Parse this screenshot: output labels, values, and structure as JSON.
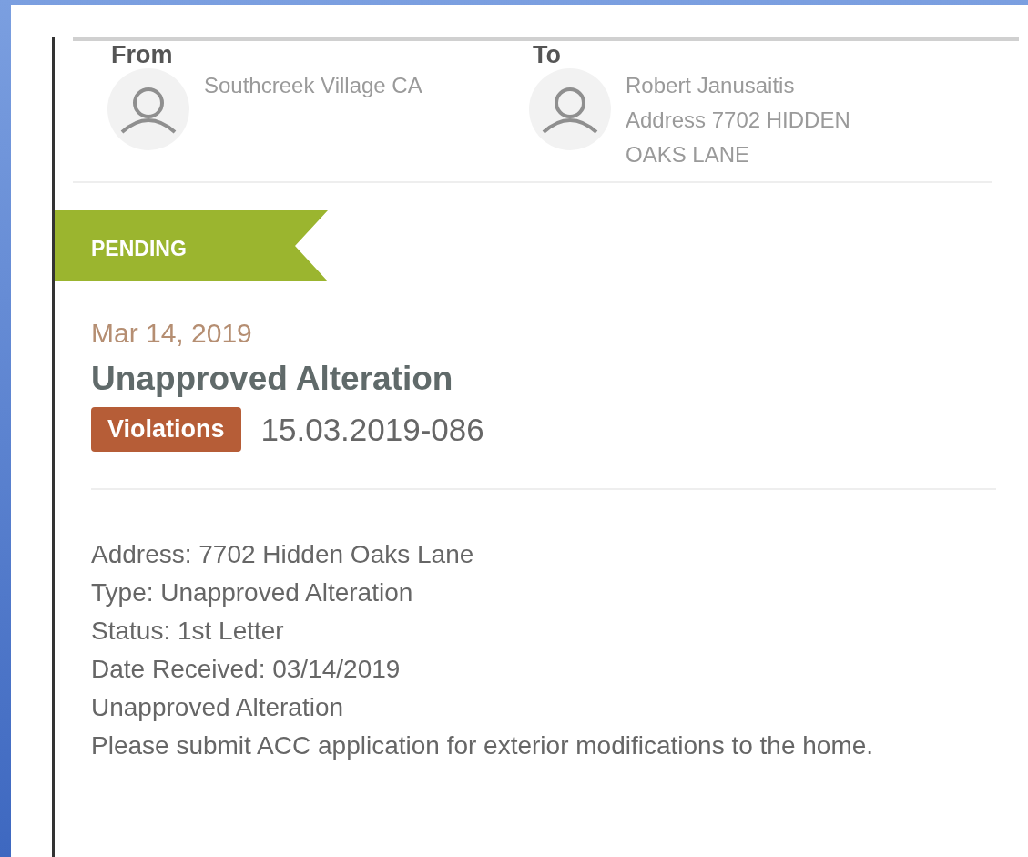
{
  "from": {
    "label": "From",
    "name": "Southcreek Village CA"
  },
  "to": {
    "label": "To",
    "name": "Robert Janusaitis",
    "address": "Address 7702 HIDDEN OAKS LANE"
  },
  "status": "PENDING",
  "date": "Mar 14, 2019",
  "title": "Unapproved Alteration",
  "category": "Violations",
  "reference": "15.03.2019-086",
  "details": [
    "Address: 7702 Hidden Oaks Lane",
    "Type: Unapproved Alteration",
    "Status: 1st Letter",
    "Date Received: 03/14/2019",
    "Unapproved Alteration",
    "Please submit ACC application for exterior modifications to the home."
  ]
}
